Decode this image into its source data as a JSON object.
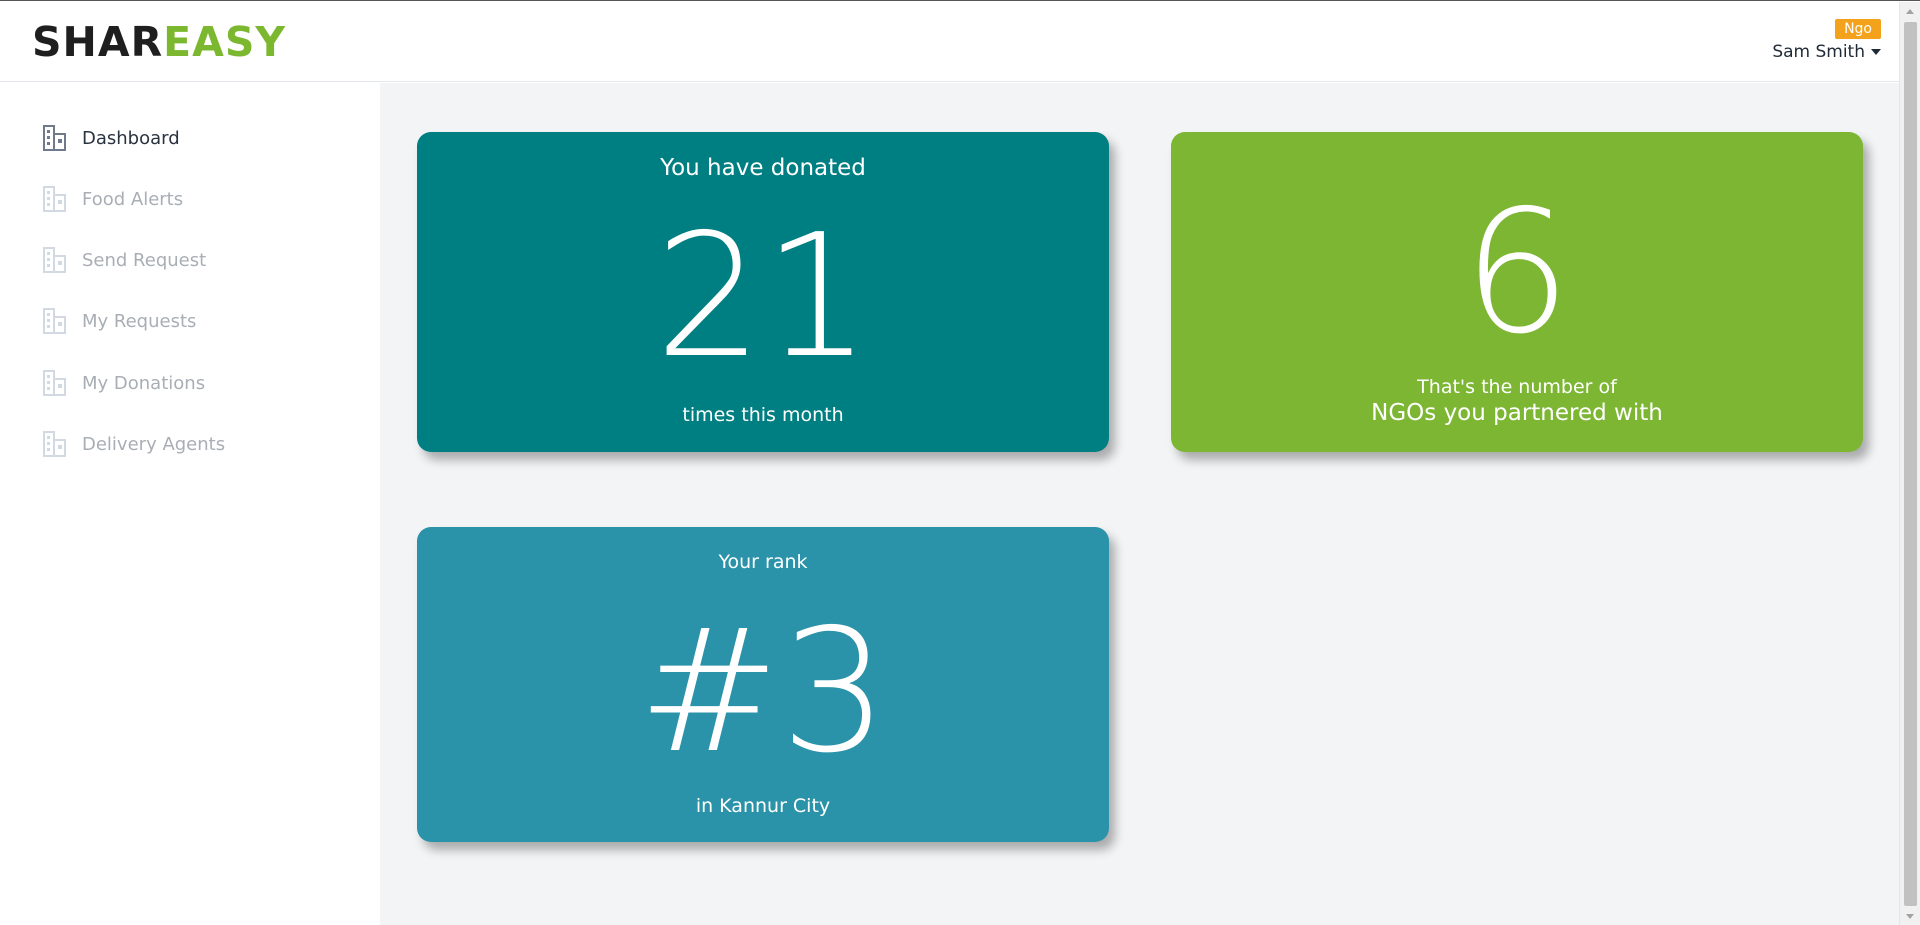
{
  "brand": {
    "part1": "SHAR",
    "part2": "EASY"
  },
  "user": {
    "role_badge": "Ngo",
    "name": "Sam Smith"
  },
  "sidebar": {
    "items": [
      {
        "label": "Dashboard",
        "active": true
      },
      {
        "label": "Food Alerts",
        "active": false
      },
      {
        "label": "Send Request",
        "active": false
      },
      {
        "label": "My Requests",
        "active": false
      },
      {
        "label": "My Donations",
        "active": false
      },
      {
        "label": "Delivery Agents",
        "active": false
      }
    ]
  },
  "cards": {
    "donations": {
      "top": "You have donated",
      "value": "21",
      "bottom": "times this month"
    },
    "partners": {
      "value": "6",
      "line1": "That's the number of",
      "line2": "NGOs you partnered with"
    },
    "rank": {
      "top": "Your rank",
      "value": "#3",
      "bottom": "in Kannur City"
    }
  },
  "colors": {
    "brand_green": "#7cb82f",
    "card_teal": "#007f82",
    "card_green": "#7cb633",
    "card_blue": "#2b93a9",
    "badge_orange": "#f4a21b"
  },
  "icons": {
    "nav": "building-icon",
    "user_menu": "caret-down-icon"
  }
}
